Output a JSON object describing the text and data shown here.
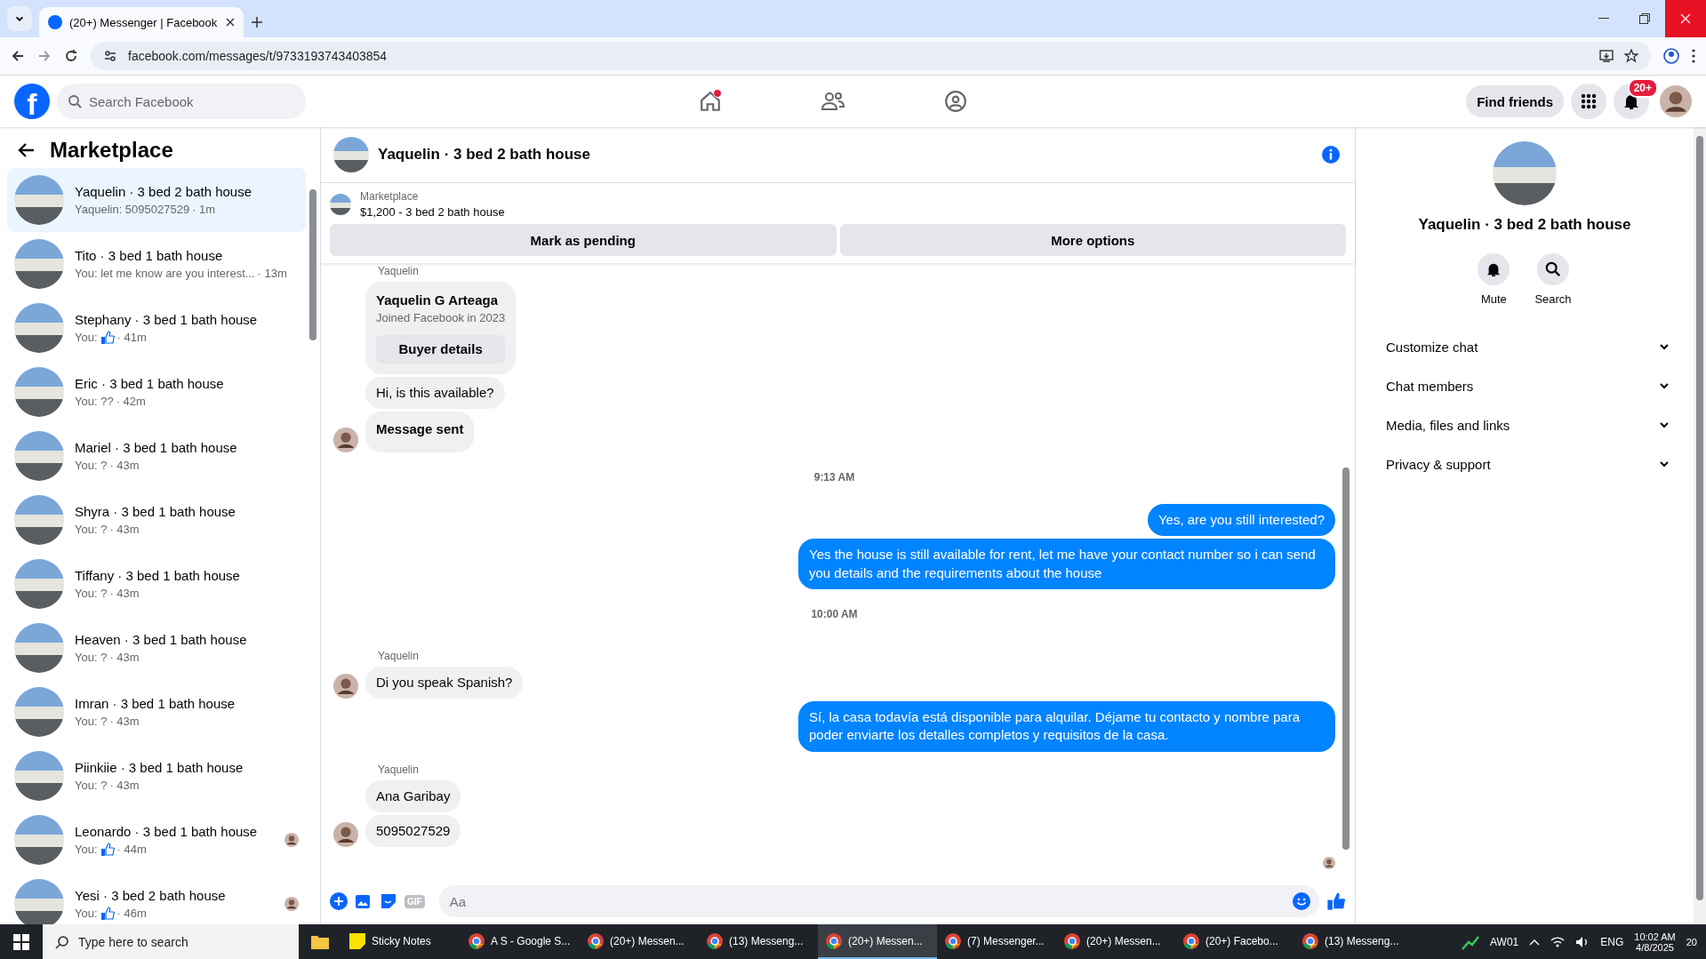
{
  "browser": {
    "tab_title": "(20+) Messenger | Facebook",
    "url": "facebook.com/messages/t/9733193743403854"
  },
  "facebook_nav": {
    "logo": "f",
    "search_placeholder": "Search Facebook",
    "nav": [
      {
        "dot": true
      },
      {
        "dot": false
      },
      {
        "dot": false
      }
    ],
    "find_friends": "Find friends",
    "notifications_badge": "20+"
  },
  "sidebar": {
    "title": "Marketplace",
    "conversations": [
      {
        "name": "Yaquelin · 3 bed 2 bath house",
        "preview": "Yaquelin: 5095027529",
        "time": "· 1m",
        "like": false,
        "seen_avatar": false,
        "selected": true
      },
      {
        "name": "Tito · 3 bed 1 bath house",
        "preview": "You: let me know are you interest...",
        "time": "· 13m",
        "like": false,
        "seen_avatar": false,
        "selected": false
      },
      {
        "name": "Stephany · 3 bed 1 bath house",
        "preview": "You:",
        "time": "· 41m",
        "like": true,
        "seen_avatar": false,
        "selected": false
      },
      {
        "name": "Eric · 3 bed 1 bath house",
        "preview": "You: ??",
        "time": "· 42m",
        "like": false,
        "seen_avatar": false,
        "selected": false
      },
      {
        "name": "Mariel · 3 bed 1 bath house",
        "preview": "You: ?",
        "time": "· 43m",
        "like": false,
        "seen_avatar": false,
        "selected": false
      },
      {
        "name": "Shyra · 3 bed 1 bath house",
        "preview": "You: ?",
        "time": "· 43m",
        "like": false,
        "seen_avatar": false,
        "selected": false
      },
      {
        "name": "Tiffany · 3 bed 1 bath house",
        "preview": "You: ?",
        "time": "· 43m",
        "like": false,
        "seen_avatar": false,
        "selected": false
      },
      {
        "name": "Heaven · 3 bed 1 bath house",
        "preview": "You: ?",
        "time": "· 43m",
        "like": false,
        "seen_avatar": false,
        "selected": false
      },
      {
        "name": "Imran · 3 bed 1 bath house",
        "preview": "You: ?",
        "time": "· 43m",
        "like": false,
        "seen_avatar": false,
        "selected": false
      },
      {
        "name": "Piinkiie · 3 bed 1 bath house",
        "preview": "You: ?",
        "time": "· 43m",
        "like": false,
        "seen_avatar": false,
        "selected": false
      },
      {
        "name": "Leonardo · 3 bed 1 bath house",
        "preview": "You:",
        "time": "· 44m",
        "like": true,
        "seen_avatar": true,
        "selected": false
      },
      {
        "name": "Yesi · 3 bed 2 bath house",
        "preview": "You:",
        "time": "· 46m",
        "like": true,
        "seen_avatar": true,
        "selected": false
      }
    ]
  },
  "chat": {
    "title": "Yaquelin · 3 bed 2 bath house",
    "listing": {
      "label": "Marketplace",
      "summary": "$1,200 - 3 bed 2 bath house",
      "buttons": [
        "Mark as pending",
        "More options"
      ]
    },
    "messages": [
      {
        "kind": "sender",
        "text": "Yaquelin"
      },
      {
        "kind": "card",
        "title": "Yaquelin G Arteaga",
        "subtitle": "Joined Facebook in 2023",
        "button": "Buyer details"
      },
      {
        "kind": "incoming",
        "text": "Hi, is this available?",
        "avatar": false
      },
      {
        "kind": "bold_incoming",
        "text": "Message sent",
        "avatar": true
      },
      {
        "kind": "time",
        "text": "9:13 AM"
      },
      {
        "kind": "outgoing",
        "text": "Yes, are you still interested?"
      },
      {
        "kind": "outgoing",
        "text": "Yes the house is still available for rent, let me have your contact number so i can send you details and the requirements about the house"
      },
      {
        "kind": "time",
        "text": "10:00 AM"
      },
      {
        "kind": "sender",
        "text": "Yaquelin"
      },
      {
        "kind": "incoming",
        "text": "Di you speak Spanish?",
        "avatar": true
      },
      {
        "kind": "outgoing",
        "text": "Sí, la casa todavía está disponible para alquilar. Déjame tu contacto y nombre para poder enviarte los detalles completos y requisitos de la casa."
      },
      {
        "kind": "sender",
        "text": "Yaquelin"
      },
      {
        "kind": "incoming",
        "text": "Ana Garibay",
        "avatar": false
      },
      {
        "kind": "incoming",
        "text": "5095027529",
        "avatar": true
      }
    ],
    "seen_indicator": true,
    "composer": {
      "placeholder": "Aa",
      "gif": "GIF"
    }
  },
  "details": {
    "name": "Yaquelin · 3 bed 2 bath house",
    "actions": [
      "Mute",
      "Search"
    ],
    "sections": [
      "Customize chat",
      "Chat members",
      "Media, files and links",
      "Privacy & support"
    ]
  },
  "taskbar": {
    "search_placeholder": "Type here to search",
    "apps": [
      {
        "label": "Sticky Notes",
        "kind": "notes",
        "selected": false
      },
      {
        "label": "A S - Google S...",
        "kind": "browser",
        "selected": false
      },
      {
        "label": "(20+) Messen...",
        "kind": "browser",
        "selected": false
      },
      {
        "label": "(13) Messeng...",
        "kind": "browser",
        "selected": false
      },
      {
        "label": "(20+) Messen...",
        "kind": "browser",
        "selected": true
      },
      {
        "label": "(7) Messenger...",
        "kind": "browser",
        "selected": false
      },
      {
        "label": "(20+) Messen...",
        "kind": "browser",
        "selected": false
      },
      {
        "label": "(20+) Facebo...",
        "kind": "browser",
        "selected": false
      },
      {
        "label": "(13) Messeng...",
        "kind": "browser",
        "selected": false
      }
    ],
    "stock": "AW01",
    "language": "ENG",
    "time": "10:02 AM",
    "date": "4/8/2025",
    "notifications": "20"
  }
}
